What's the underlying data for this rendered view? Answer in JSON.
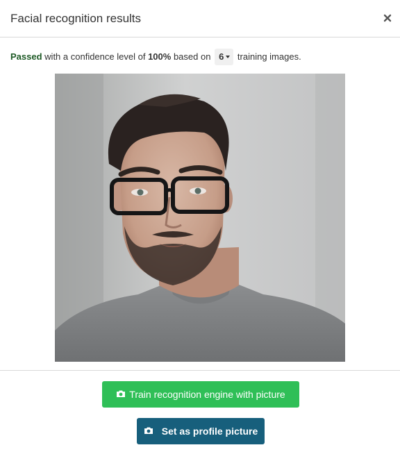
{
  "modal": {
    "title": "Facial recognition results",
    "close_icon": "close-icon"
  },
  "summary": {
    "status": "Passed",
    "text_before_confidence": "with a confidence level of",
    "confidence": "100%",
    "text_before_count": "based on",
    "training_images_count": "6",
    "text_after_count": "training images.",
    "status_color": "#1e5a26"
  },
  "photo": {
    "subject": "portrait-photo"
  },
  "actions": {
    "train_label": "Train recognition engine with picture",
    "train_icon": "camera-icon",
    "train_color": "#2fbf57",
    "profile_label": "Set as profile picture",
    "profile_icon": "camera-icon",
    "profile_color": "#175f7c"
  }
}
